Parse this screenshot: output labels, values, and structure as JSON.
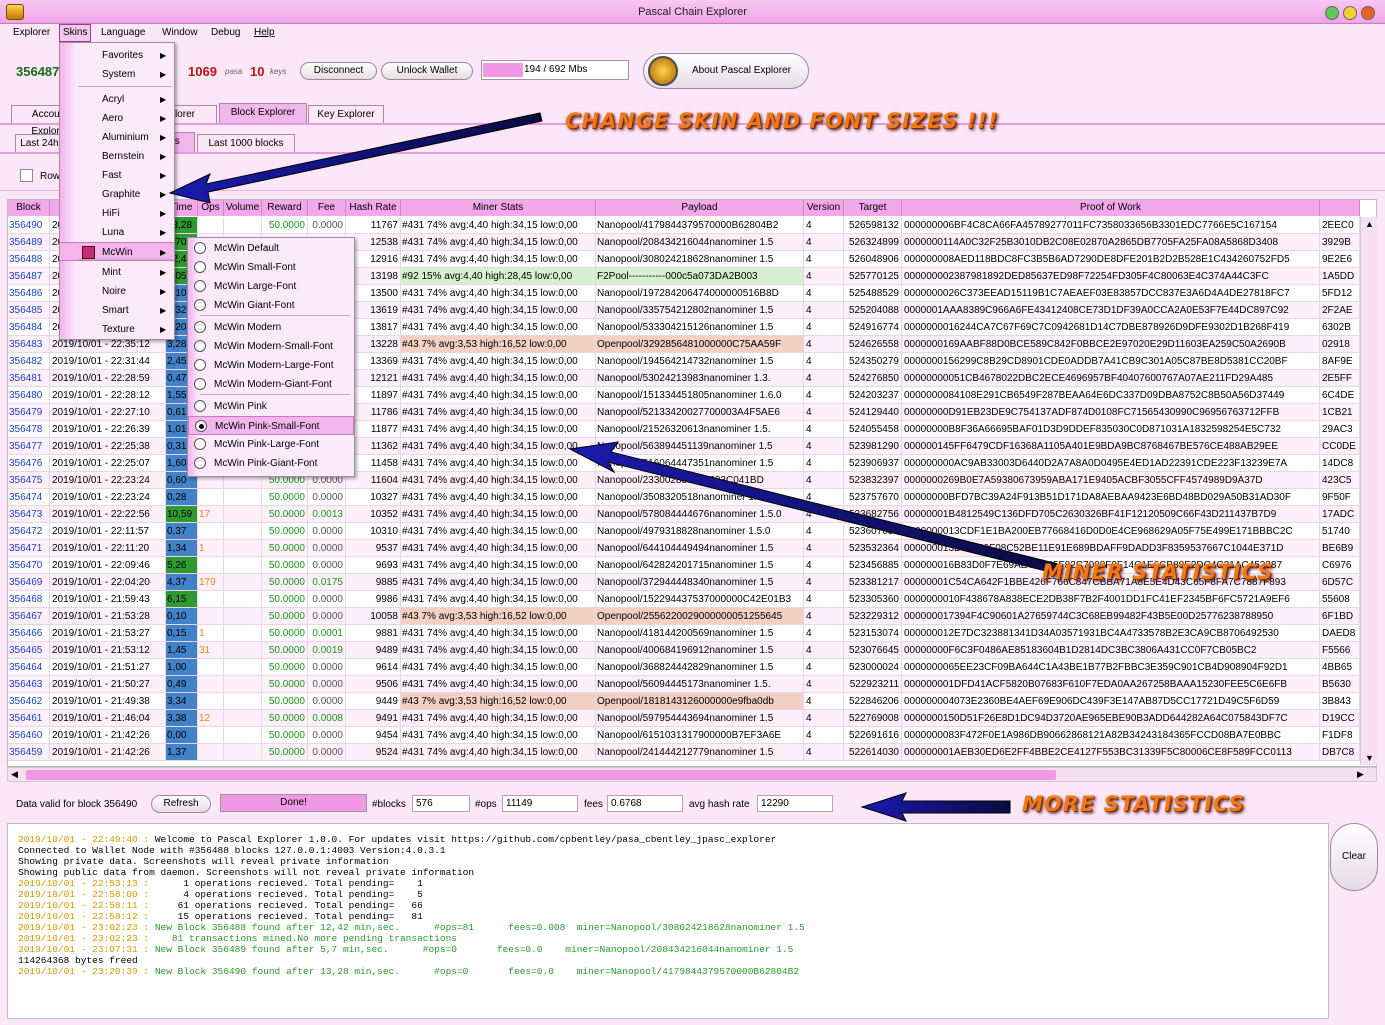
{
  "window": {
    "title": "Pascal Chain Explorer"
  },
  "menubar": [
    "Explorer",
    "Skins",
    "Language",
    "Window",
    "Debug",
    "Help"
  ],
  "status": {
    "block": "356487",
    "block_label": "block",
    "pasc": "1069",
    "pasc_label": "pasa",
    "keys": "10",
    "keys_label": "keys",
    "blurred_value": "592742"
  },
  "buttons": {
    "disconnect": "Disconnect",
    "unlock": "Unlock Wallet",
    "memory": "194 / 692 Mbs",
    "about": "About Pascal Explorer"
  },
  "tabs": [
    "Account Explorer",
    "Operation Explorer",
    "Block Explorer",
    "Key Explorer"
  ],
  "subtabs": [
    "Last 24h blocks",
    "Last 100 blocks",
    "Last 1000 blocks"
  ],
  "rows_label": "Rows",
  "annotations": {
    "skins": "CHANGE SKIN AND FONT SIZES !!!",
    "miner": "MINER STATISTICS",
    "more": "MORE STATISTICS"
  },
  "columns": [
    "Block",
    "Date",
    "Time",
    "Ops",
    "Volume",
    "Reward",
    "Fee",
    "Hash Rate",
    "Miner Stats",
    "Payload",
    "Version",
    "Target",
    "Proof of Work",
    ""
  ],
  "rows": [
    [
      "356490",
      "2019/10/01 - 22:49:40",
      "13,28",
      "",
      "",
      "50.0000",
      "0.0000",
      "11767",
      "#431 74% avg:4,40 high:34,15 low:0,00",
      "Nanopool/4179844379570000B62804B2",
      "4",
      "526598132",
      "000000006BF4C8CA66FA45789277011FC7358033656B3301EDC7766E5C167154",
      "2EEC0"
    ],
    [
      "356489",
      "2019/10/01 - 22:31:20",
      "5,70",
      "",
      "",
      "50.0000",
      "0.0000",
      "12538",
      "#431 74% avg:4,40 high:34,15 low:0,00",
      "Nanopool/208434216044nanominer 1.5",
      "4",
      "526324899",
      "0000000114A0C32F25B3010DB2C08E02870A2865DB7705FA25FA08A5868D3408",
      "3929B"
    ],
    [
      "356488",
      "2019/10/01 - 22:23:20",
      "12,42",
      "",
      "",
      "50.0000",
      "0.0080",
      "12916",
      "#431 74% avg:4,40 high:34,15 low:0,00",
      "Nanopool/308024218628nanominer 1.5",
      "4",
      "526048906",
      "000000008AED118BDC8FC3B5B6AD7290DE8DFE201B2D2B528E1C434260752FD5",
      "9E2E6"
    ],
    [
      "356487",
      "2019/10/01 - 22:48:45",
      "7,05",
      "",
      "",
      "50.0000",
      "0.0000",
      "13198",
      "#92 15% avg:4,40 high:28,45 low:0,00",
      "F2Pool-----------000c5a073DA2B003",
      "4",
      "525770125",
      "000000002387981892DED85637ED98F72254FD305F4C80063E4C374A44C3FC",
      "1A5DD"
    ],
    [
      "356486",
      "2019/10/01 - 22:36:45",
      "1,10",
      "",
      "",
      "50.0000",
      "0.0012",
      "13500",
      "#431 74% avg:4,40 high:34,15 low:0,00",
      "Nanopool/197284206474000000516B8D",
      "4",
      "525488529",
      "0000000026C373EEAD15119B1C7AEAEF03E83857DCC837E3A6D4A4DE27818FC7",
      "5FD12"
    ],
    [
      "356485",
      "2019/10/01 - 22:35:50",
      "1,32",
      "",
      "",
      "50.0000",
      "0.0000",
      "13619",
      "#431 74% avg:4,40 high:34,15 low:0,00",
      "Nanopool/335754212802nanominer 1.5",
      "4",
      "525204088",
      "0000001AAA8389C966A6FE43412408CE73D1DF39A0CCA2A0E53F7E44DC897C92",
      "2F2AE"
    ],
    [
      "356484",
      "2019/10/01 - 22:35:29",
      "3,20",
      "",
      "",
      "50.0000",
      "0.0000",
      "13817",
      "#431 74% avg:4,40 high:34,15 low:0,00",
      "Nanopool/533304215126nanominer 1.5",
      "4",
      "524916774",
      "0000000016244CA7C67F69C7C0942681D14C7DBE878926D9DFE9302D1B268F419",
      "6302B"
    ],
    [
      "356483",
      "2019/10/01 - 22:35:12",
      "3,28",
      "",
      "",
      "50.0000",
      "0.0000",
      "13228",
      "#43 7% avg:3,53 high:16,52 low:0,00",
      "Openpool/3292856481000000C75AA59F",
      "4",
      "524626558",
      "0000000169AABF88D0BCE589C842F0BBCE2E97020E29D11603EA259C50A2690B",
      "02918"
    ],
    [
      "356482",
      "2019/10/01 - 22:31:44",
      "2,45",
      "",
      "",
      "50.0000",
      "0.0000",
      "13369",
      "#431 74% avg:4,40 high:34,15 low:0,00",
      "Nanopool/194564214732nanominer 1.5",
      "4",
      "524350279",
      "0000000156299C8B29CD8901CDE0ADDB7A41CB9C301A05C87BE8D5381CC20BF",
      "8AF9E"
    ],
    [
      "356481",
      "2019/10/01 - 22:28:59",
      "0,47",
      "",
      "",
      "50.0000",
      "0.0000",
      "12121",
      "#431 74% avg:4,40 high:34,15 low:0,00",
      "Nanopool/53024213983nanominer 1.3.",
      "4",
      "524276850",
      "00000000051CB4678022DBC2ECE4696957BF40407600767A07AE211FD29A485",
      "2E5FF"
    ],
    [
      "356480",
      "2019/10/01 - 22:28:12",
      "1,55",
      "",
      "",
      "50.0000",
      "0.0000",
      "11897",
      "#431 74% avg:4,40 high:34,15 low:0,00",
      "Nanopool/151334451805nanominer 1.6.0",
      "4",
      "524203237",
      "0000000084108E291CB6549F287BEAA64E6DC337D09DBA8752C8B50A56D37449",
      "6C4DE"
    ],
    [
      "356479",
      "2019/10/01 - 22:27:10",
      "0,61",
      "",
      "",
      "50.0000",
      "0.0000",
      "11786",
      "#431 74% avg:4,40 high:34,15 low:0,00",
      "Nanopool/52133420027700003A4F5AE6",
      "4",
      "524129440",
      "00000000D91EB23DE9C754137ADF874D0108FC71565430990C96956763712FFB",
      "1CB21"
    ],
    [
      "356478",
      "2019/10/01 - 22:26:39",
      "1,01",
      "",
      "",
      "50.0000",
      "0.0000",
      "11877",
      "#431 74% avg:4,40 high:34,15 low:0,00",
      "Nanopool/21526320613nanominer 1.5.",
      "4",
      "524055458",
      "00000000B8F36A66695BAF01D3D9DDEF835030C0D871031A1832598254E5C732",
      "29AC3"
    ],
    [
      "356477",
      "2019/10/01 - 22:25:38",
      "0,31",
      "",
      "",
      "50.0000",
      "0.0000",
      "11362",
      "#431 74% avg:4,40 high:34,15 low:0,00",
      "Nanopool/563894451139nanominer 1.5",
      "4",
      "523981290",
      "000000145FF6479CDF16368A1105A401E9BDA9BC8768467BE576CE488AB29EE",
      "CC0DE"
    ],
    [
      "356476",
      "2019/10/01 - 22:25:07",
      "1,60",
      "",
      "",
      "50.0000",
      "0.0000",
      "11458",
      "#431 74% avg:4,40 high:34,15 low:0,00",
      "Nanopool/516064447351nanominer 1.5",
      "4",
      "523906937",
      "000000000AC9AB33003D6440D2A7A8A0D0495E4ED1AD22391CDE223F13239E7A",
      "14DC8"
    ],
    [
      "356475",
      "2019/10/01 - 22:23:24",
      "0,60",
      "",
      "",
      "50.0000",
      "0.0000",
      "11604",
      "#431 74% avg:4,40 high:34,15 low:0,00",
      "Nanopool/233002880000093C041BD",
      "4",
      "523832397",
      "0000000269B0E7A59380673959ABA171E9405ACBF3055CFF4574989D9A37D",
      "423C5"
    ],
    [
      "356474",
      "2019/10/01 - 22:23:24",
      "0,28",
      "",
      "",
      "50.0000",
      "0.0000",
      "10327",
      "#431 74% avg:4,40 high:34,15 low:0,00",
      "Nanopool/3508320518nanominer 1.5.0",
      "4",
      "523757670",
      "00000000BFD7BC39A24F913B51D171DA8AEBAA9423E6BD48BD029A50B31AD30F",
      "9F50F"
    ],
    [
      "356473",
      "2019/10/01 - 22:22:56",
      "10,59",
      "17",
      "",
      "50.0000",
      "0.0013",
      "10352",
      "#431 74% avg:4,40 high:34,15 low:0,00",
      "Nanopool/578084444676nanominer 1.5.0",
      "4",
      "523682756",
      "00000001B4812549C136DFD705C2630326BF41F12120509C66F43D211437B7D9",
      "17ADC"
    ],
    [
      "356472",
      "2019/10/01 - 22:11:57",
      "0,37",
      "",
      "",
      "50.0000",
      "0.0000",
      "10310",
      "#431 74% avg:4,40 high:34,15 low:0,00",
      "Nanopool/4979318828nanominer 1.5.0",
      "4",
      "523607654",
      "0000000013CDF1E1BA200EB77668416D0D0E4CE968629A05F75E499E171BBBC2C",
      "51740"
    ],
    [
      "356471",
      "2019/10/01 - 22:11:20",
      "1,34",
      "1",
      "",
      "50.0000",
      "0.0000",
      "9537",
      "#431 74% avg:4,40 high:34,15 low:0,00",
      "Nanopool/644104449494nanominer 1.5",
      "4",
      "523532364",
      "000000013D98660F08C52BE11E91E689BDAFF9DADD3F8359537667C1044E371D",
      "BE6B9"
    ],
    [
      "356470",
      "2019/10/01 - 22:09:46",
      "5,26",
      "",
      "",
      "50.0000",
      "0.0000",
      "9693",
      "#431 74% avg:4,40 high:34,15 low:0,00",
      "Nanopool/642824201715nanominer 1.5",
      "4",
      "523456885",
      "000000016B83D0F7E69AE4DD45F82C7008F9F14C1E6CB88E2DC4C21AC452387",
      "C6976"
    ],
    [
      "356469",
      "2019/10/01 - 22:04:20",
      "4,37",
      "179",
      "",
      "50.0000",
      "0.0175",
      "9885",
      "#431 74% avg:4,40 high:34,15 low:0,00",
      "Nanopool/372944448340nanominer 1.5",
      "4",
      "523381217",
      "00000001C54CA642F1BBE426F766C847CBBA71A8E5E4D43C65F8FA7C7887F893",
      "6D57C"
    ],
    [
      "356468",
      "2019/10/01 - 21:59:43",
      "6,15",
      "",
      "",
      "50.0000",
      "0.0000",
      "9986",
      "#431 74% avg:4,40 high:34,15 low:0,00",
      "Nanopool/152294437537000000C42E01B3",
      "4",
      "523305360",
      "0000000010F438678A838ECE2DB38F7B2F4001DD1FC41EF2345BF6FC5721A9EF6",
      "55608"
    ],
    [
      "356467",
      "2019/10/01 - 21:53:28",
      "0,10",
      "",
      "",
      "50.0000",
      "0.0000",
      "10058",
      "#43 7% avg:3,53 high:16,52 low:0,00",
      "Openpool/2556220029000000051255645",
      "4",
      "523229312",
      "000000017394F4C90601A27659744C3C68EB99482F43B5E00D25776238788950",
      "6F1BD"
    ],
    [
      "356466",
      "2019/10/01 - 21:53:27",
      "0,15",
      "1",
      "",
      "50.0000",
      "0.0001",
      "9881",
      "#431 74% avg:4,40 high:34,15 low:0,00",
      "Nanopool/418144200569nanominer 1.5",
      "4",
      "523153074",
      "000000012E7DC323881341D34A03571931BC4A4733578B2E3CA9CB8706492530",
      "DAED8"
    ],
    [
      "356465",
      "2019/10/01 - 21:53:12",
      "1,45",
      "31",
      "",
      "50.0000",
      "0.0019",
      "9489",
      "#431 74% avg:4,40 high:34,15 low:0,00",
      "Nanopool/400684196912nanominer 1.5",
      "4",
      "523076645",
      "00000000F6C3F0486AE85183604B1D2814DC3BC3806A431CC0F7CB05BC2",
      "F5566"
    ],
    [
      "356464",
      "2019/10/01 - 21:51:27",
      "1,00",
      "",
      "",
      "50.0000",
      "0.0000",
      "9614",
      "#431 74% avg:4,40 high:34,15 low:0,00",
      "Nanopool/368824442829nanominer 1.5",
      "4",
      "523000024",
      "0000000065EE23CF09BA644C1A43BE1B77B2FBBC3E359C901CB4D908904F92D1",
      "4BB65"
    ],
    [
      "356463",
      "2019/10/01 - 21:50:27",
      "0,49",
      "",
      "",
      "50.0000",
      "0.0000",
      "9506",
      "#431 74% avg:4,40 high:34,15 low:0,00",
      "Nanopool/56094445173nanominer 1.5.",
      "4",
      "522923211",
      "000000001DFD41ACF5820B07683F610F7EDA0AA267258BAAA15230FEE5C6E6FB",
      "B5630"
    ],
    [
      "356462",
      "2019/10/01 - 21:49:38",
      "3,34",
      "",
      "",
      "50.0000",
      "0.0000",
      "9449",
      "#43 7% avg:3,53 high:16,52 low:0,00",
      "Openpool/1818143126000000e9fba0db",
      "4",
      "522846206",
      "000000004073E2360BE4AEF69E906DC439F3E147AB87D5CC17721D49C5F6D59",
      "3B843"
    ],
    [
      "356461",
      "2019/10/01 - 21:46:04",
      "3,38",
      "12",
      "",
      "50.0000",
      "0.0008",
      "9491",
      "#431 74% avg:4,40 high:34,15 low:0,00",
      "Nanopool/597954443694nanominer 1.5",
      "4",
      "522769008",
      "0000000150D51F26E8D1DC94D3720AE965EBE90B3ADD644282A64C075843DF7C",
      "D19CC"
    ],
    [
      "356460",
      "2019/10/01 - 21:42:26",
      "0,00",
      "",
      "",
      "50.0000",
      "0.0000",
      "9454",
      "#431 74% avg:4,40 high:34,15 low:0,00",
      "Nanopool/6151031317900000B7EF3A6E",
      "4",
      "522691616",
      "0000000083F472F0E1A986DB90662868121A82B34243184365FCCD08BA7E0BBC",
      "F1DF8"
    ],
    [
      "356459",
      "2019/10/01 - 21:42:26",
      "1,37",
      "",
      "",
      "50.0000",
      "0.0000",
      "9524",
      "#431 74% avg:4,40 high:34,15 low:0,00",
      "Nanopool/241444212779nanominer 1.5",
      "4",
      "522614030",
      "000000001AEB30ED6E2FF4BBE2CE4127F553BC31339F5C80006CE8F589FCC0113",
      "DB7C8"
    ]
  ],
  "skins_menu": [
    "Favorites",
    "System",
    "Acryl",
    "Aero",
    "Aluminium",
    "Bernstein",
    "Fast",
    "Graphite",
    "HiFi",
    "Luna",
    "McWin",
    "Mint",
    "Noire",
    "Smart",
    "Texture"
  ],
  "mcwin_menu": [
    "McWin Default",
    "McWin Small-Font",
    "McWin Large-Font",
    "McWin Giant-Font",
    "McWin Modern",
    "McWin Modern-Small-Font",
    "McWin Modern-Large-Font",
    "McWin Modern-Giant-Font",
    "McWin Pink",
    "McWin Pink-Small-Font",
    "McWin Pink-Large-Font",
    "McWin Pink-Giant-Font"
  ],
  "footer": {
    "valid_label": "Data valid for block 356490",
    "refresh": "Refresh",
    "done": "Done!",
    "blocks_label": "#blocks",
    "blocks": "576",
    "ops_label": "#ops",
    "ops": "11149",
    "fees_label": "fees",
    "fees": "0.6768",
    "hash_label": "avg hash rate",
    "hash": "12290",
    "clear": "Clear"
  },
  "log": [
    {
      "c": "#d49a00",
      "t": "2019/10/01 - 22:49:40 : "
    },
    {
      "c": "#000",
      "t": "Welcome to Pascal Explorer 1.0.0. For updates visit https://github.com/cpbentley/pasa_cbentley_jpasc_explorer"
    },
    {
      "c": "#000",
      "t": "Connected to Wallet Node with #356488 blocks 127.0.0.1:4003 Version:4.0.3.1"
    },
    {
      "c": "#000",
      "t": "Showing private data. Screenshots will reveal private information"
    },
    {
      "c": "#000",
      "t": "Showing public data from daemon. Screenshots will not reveal private information"
    }
  ],
  "log_lines": [
    [
      "2019/10/01 - 22:49:40 : ",
      "Welcome to Pascal Explorer 1.0.0. For updates visit https://github.com/cpbentley/pasa_cbentley_jpasc_explorer",
      "#000"
    ],
    [
      "",
      "Connected to Wallet Node with #356488 blocks 127.0.0.1:4003 Version:4.0.3.1",
      "#000"
    ],
    [
      "",
      "Showing private data. Screenshots will reveal private information",
      "#000"
    ],
    [
      "",
      "Showing public data from daemon. Screenshots will not reveal private information",
      "#000"
    ],
    [
      "2019/10/01 - 22:53:13 : ",
      "     1 operations recieved. Total pending=    1",
      "#000"
    ],
    [
      "2019/10/01 - 22:58:00 : ",
      "     4 operations recieved. Total pending=    5",
      "#000"
    ],
    [
      "2019/10/01 - 22:58:11 : ",
      "    61 operations recieved. Total pending=   66",
      "#000"
    ],
    [
      "2019/10/01 - 22:58:12 : ",
      "    15 operations recieved. Total pending=   81",
      "#000"
    ],
    [
      "2019/10/01 - 23:02:23 : ",
      "New Block 356488 found after 12,42 min,sec.      #ops=81      fees=0.008  miner=Nanopool/308024218628nanominer 1.5",
      "#2a9a2a"
    ],
    [
      "2019/10/01 - 23:02:23 : ",
      "   81 transactions mined.No more pending transactions",
      "#2a9a2a"
    ],
    [
      "2019/10/01 - 23:07:31 : ",
      "New Block 356489 found after 5,7 min,sec.      #ops=0       fees=0.0    miner=Nanopool/208434216044nanominer 1.5",
      "#2a9a2a"
    ],
    [
      "",
      "114264368 bytes freed",
      "#000"
    ],
    [
      "2019/10/01 - 23:20:39 : ",
      "New Block 356490 found after 13,28 min,sec.      #ops=0       fees=0.0    miner=Nanopool/4179844379570000B62804B2",
      "#2a9a2a"
    ]
  ]
}
